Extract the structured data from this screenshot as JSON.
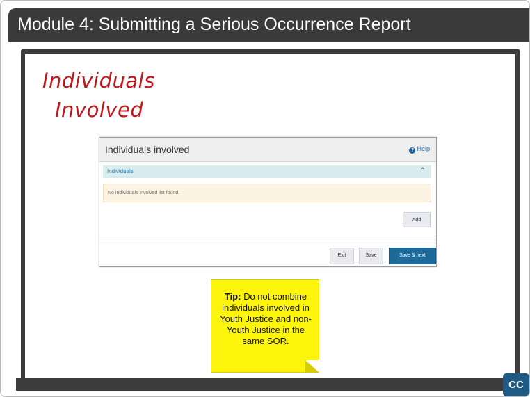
{
  "module_title": "Module 4:  Submitting a Serious Occurrence Report",
  "slide_heading": {
    "line1": "Individuals",
    "line2": "Involved"
  },
  "panel": {
    "title": "Individuals involved",
    "help_label": "Help",
    "help_icon": "?",
    "section_label": "Individuals",
    "chevron": "⌃",
    "empty_message": "No individuals involved list found.",
    "add_label": "Add",
    "exit_label": "Exit",
    "save_label": "Save",
    "save_next_label": "Save & next"
  },
  "tip": {
    "label": "Tip:",
    "text": " Do not combine individuals involved in Youth Justice and non-Youth Justice in the same SOR."
  },
  "cc_label": "CC",
  "colors": {
    "accent": "#1d6a9a",
    "heading": "#c0181b",
    "tip_bg": "#fdf40c",
    "title_bar": "#3a3a3a"
  }
}
